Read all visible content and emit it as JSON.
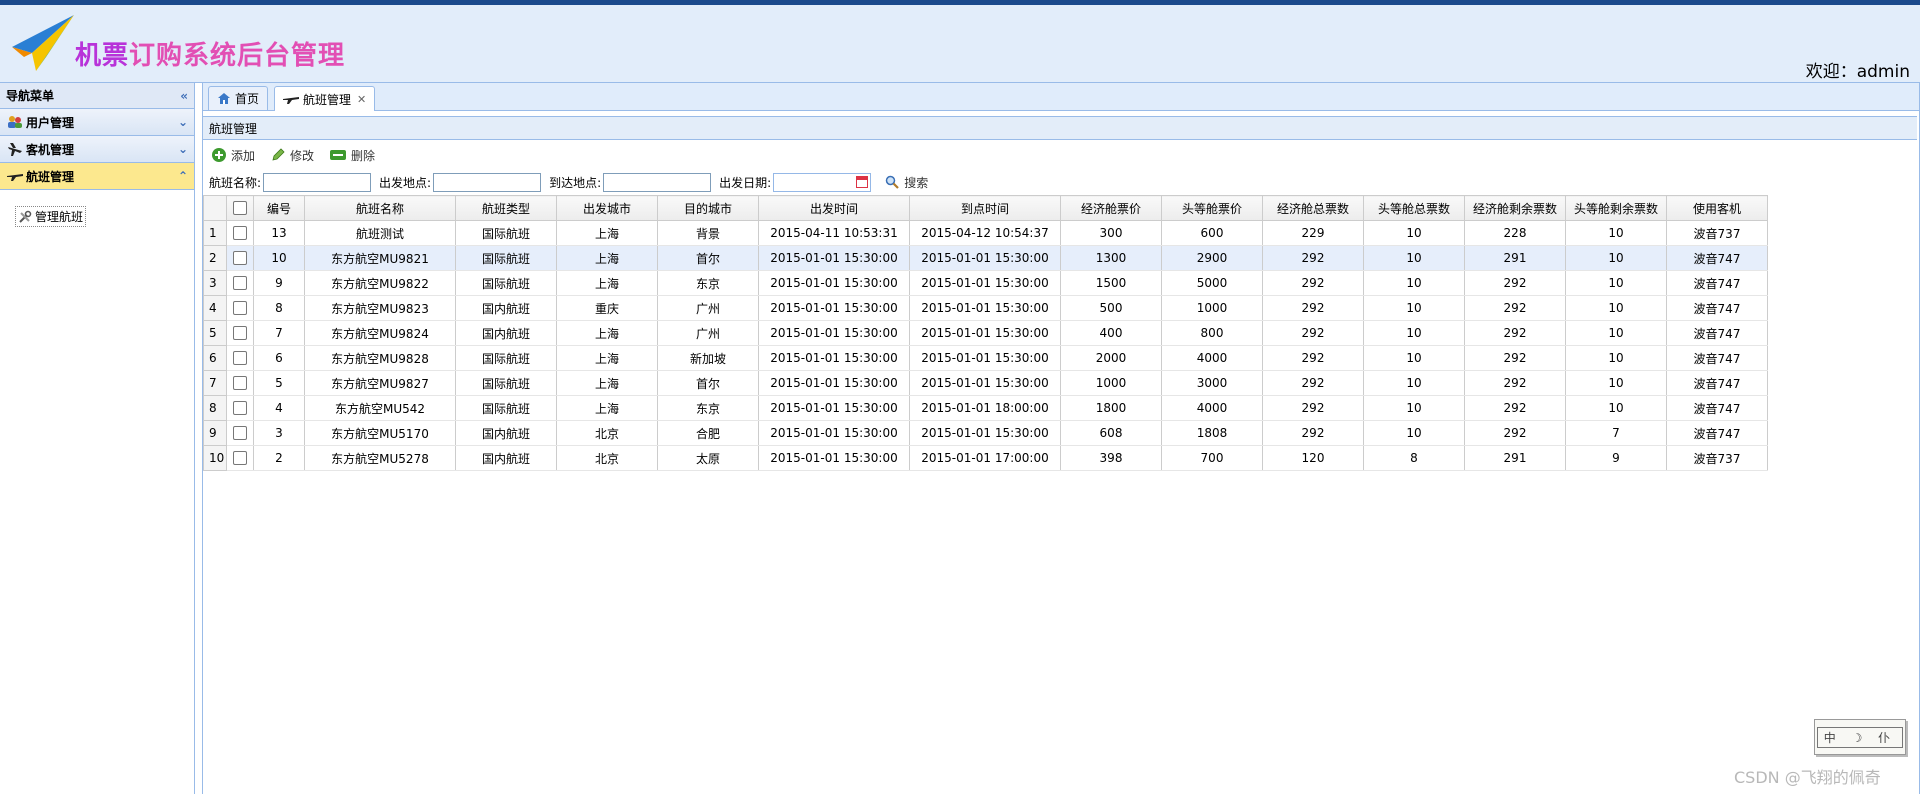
{
  "app": {
    "title_part1": "机票",
    "title_part2": "订购系统后台管理",
    "welcome_label": "欢迎：",
    "username": "admin"
  },
  "sidebar": {
    "header": "导航菜单",
    "menus": [
      {
        "label": "用户管理",
        "icon": "users-icon"
      },
      {
        "label": "客机管理",
        "icon": "airplane-icon"
      },
      {
        "label": "航班管理",
        "icon": "flight-icon",
        "active": true
      }
    ],
    "sub_item": "管理航班"
  },
  "tabs": [
    {
      "label": "首页",
      "icon": "home-icon"
    },
    {
      "label": "航班管理",
      "icon": "flight-icon",
      "closable": true,
      "active": true
    }
  ],
  "panel": {
    "title": "航班管理"
  },
  "toolbar": {
    "add": "添加",
    "edit": "修改",
    "delete": "删除"
  },
  "search": {
    "name_label": "航班名称:",
    "from_label": "出发地点:",
    "to_label": "到达地点:",
    "date_label": "出发日期:",
    "button": "搜索"
  },
  "table": {
    "columns": [
      "编号",
      "航班名称",
      "航班类型",
      "出发城市",
      "目的城市",
      "出发时间",
      "到点时间",
      "经济舱票价",
      "头等舱票价",
      "经济舱总票数",
      "头等舱总票数",
      "经济舱剩余票数",
      "头等舱剩余票数",
      "使用客机"
    ],
    "rows": [
      [
        "13",
        "航班测试",
        "国际航班",
        "上海",
        "背景",
        "2015-04-11 10:53:31",
        "2015-04-12 10:54:37",
        "300",
        "600",
        "229",
        "10",
        "228",
        "10",
        "波音737"
      ],
      [
        "10",
        "东方航空MU9821",
        "国际航班",
        "上海",
        "首尔",
        "2015-01-01 15:30:00",
        "2015-01-01 15:30:00",
        "1300",
        "2900",
        "292",
        "10",
        "291",
        "10",
        "波音747"
      ],
      [
        "9",
        "东方航空MU9822",
        "国际航班",
        "上海",
        "东京",
        "2015-01-01 15:30:00",
        "2015-01-01 15:30:00",
        "1500",
        "5000",
        "292",
        "10",
        "292",
        "10",
        "波音747"
      ],
      [
        "8",
        "东方航空MU9823",
        "国内航班",
        "重庆",
        "广州",
        "2015-01-01 15:30:00",
        "2015-01-01 15:30:00",
        "500",
        "1000",
        "292",
        "10",
        "292",
        "10",
        "波音747"
      ],
      [
        "7",
        "东方航空MU9824",
        "国内航班",
        "上海",
        "广州",
        "2015-01-01 15:30:00",
        "2015-01-01 15:30:00",
        "400",
        "800",
        "292",
        "10",
        "292",
        "10",
        "波音747"
      ],
      [
        "6",
        "东方航空MU9828",
        "国际航班",
        "上海",
        "新加坡",
        "2015-01-01 15:30:00",
        "2015-01-01 15:30:00",
        "2000",
        "4000",
        "292",
        "10",
        "292",
        "10",
        "波音747"
      ],
      [
        "5",
        "东方航空MU9827",
        "国际航班",
        "上海",
        "首尔",
        "2015-01-01 15:30:00",
        "2015-01-01 15:30:00",
        "1000",
        "3000",
        "292",
        "10",
        "292",
        "10",
        "波音747"
      ],
      [
        "4",
        "东方航空MU542",
        "国际航班",
        "上海",
        "东京",
        "2015-01-01 15:30:00",
        "2015-01-01 18:00:00",
        "1800",
        "4000",
        "292",
        "10",
        "292",
        "10",
        "波音747"
      ],
      [
        "3",
        "东方航空MU5170",
        "国内航班",
        "北京",
        "合肥",
        "2015-01-01 15:30:00",
        "2015-01-01 15:30:00",
        "608",
        "1808",
        "292",
        "10",
        "292",
        "7",
        "波音747"
      ],
      [
        "2",
        "东方航空MU5278",
        "国内航班",
        "北京",
        "太原",
        "2015-01-01 15:30:00",
        "2015-01-01 17:00:00",
        "398",
        "700",
        "120",
        "8",
        "291",
        "9",
        "波音737"
      ]
    ],
    "highlighted_row": 2
  },
  "ime": {
    "text": "中 ☽ 仆"
  },
  "watermark": "CSDN @飞翔的佩奇"
}
